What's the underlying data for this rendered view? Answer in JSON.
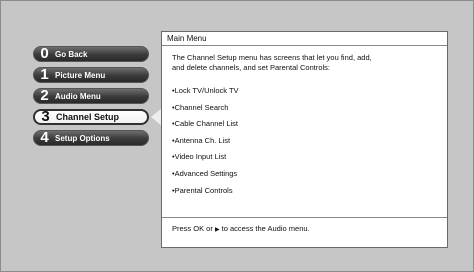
{
  "side_menu": {
    "items": [
      {
        "num": "0",
        "label": "Go Back"
      },
      {
        "num": "1",
        "label": "Picture Menu"
      },
      {
        "num": "2",
        "label": "Audio Menu"
      },
      {
        "num": "3",
        "label": "Channel Setup"
      },
      {
        "num": "4",
        "label": "Setup Options"
      }
    ],
    "selected_index": 3
  },
  "panel": {
    "title": "Main Menu",
    "intro_line1": "The Channel Setup menu has screens that let you find, add,",
    "intro_line2": "and delete channels, and set Parental Controls:",
    "items": [
      "•Lock TV/Unlock TV",
      "•Channel Search",
      "•Cable Channel List",
      "•Antenna Ch. List",
      "•Video Input List",
      "•Advanced Settings",
      "•Parental Controls"
    ],
    "footer_before": "Press OK or ",
    "footer_arrow": "▶",
    "footer_after": " to access the Audio menu."
  }
}
